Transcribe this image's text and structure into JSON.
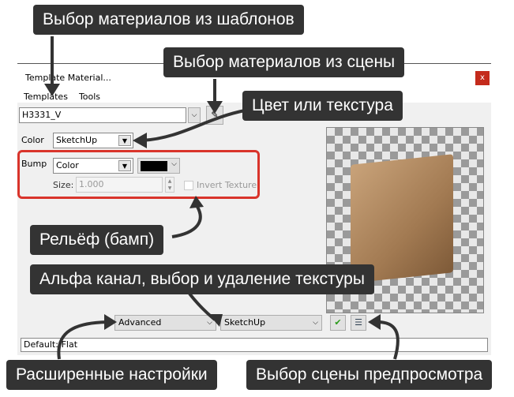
{
  "window": {
    "title": "Template Material...",
    "close": "x"
  },
  "menu": [
    "Templates",
    "Tools"
  ],
  "material_name": "H3331_V",
  "color": {
    "label": "Color",
    "value": "SketchUp"
  },
  "bump": {
    "label": "Bump",
    "value": "Color",
    "swatch": "#000000",
    "size_label": "Size:",
    "size_value": "1.000",
    "invert_label": "Invert Texture"
  },
  "bottom": {
    "mode": "Advanced",
    "scene": "SketchUp"
  },
  "status": "Default::Flat",
  "callouts": {
    "templates": "Выбор материалов из шаблонов",
    "scene_pick": "Выбор материалов из сцены",
    "color_texture": "Цвет или текстура",
    "bump": "Рельёф (бамп)",
    "alpha": "Альфа канал, выбор и удаление текстуры",
    "advanced": "Расширенные настройки",
    "preview_scene": "Выбор сцены предпросмотра"
  },
  "colors": {
    "callout_bg": "#333333",
    "highlight": "#d9342b",
    "dialog_bg": "#f0f0f0"
  }
}
